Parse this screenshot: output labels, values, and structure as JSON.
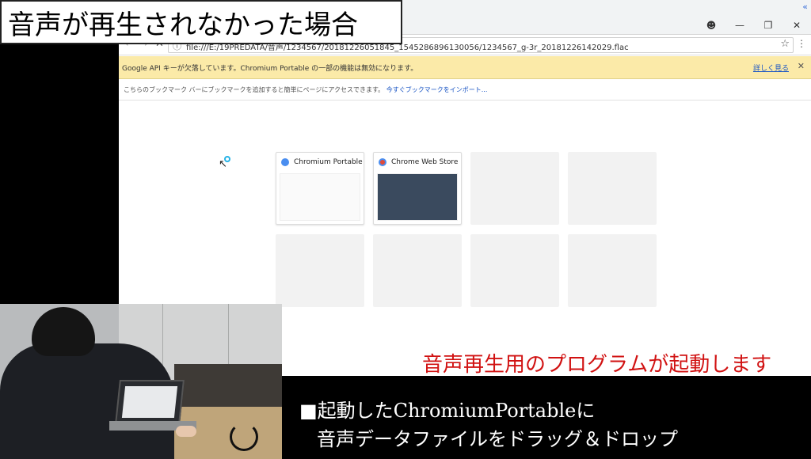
{
  "overlay": {
    "title": "音声が再生されなかった場合",
    "red_caption": "音声再生用のプログラムが起動します",
    "caption_line1": "■起動したChromiumPortableに",
    "caption_line2": "音声データファイルをドラッグ＆ドロップ"
  },
  "browser": {
    "url": "file:///E:/19PREDATA/音声/1234567/20181226051845_1545286896130056/1234567_g-3r_20181226142029.flac",
    "infobar_message": "Google API キーが欠落しています。Chromium Portable の一部の機能は無効になります。",
    "infobar_link": "詳しく見る",
    "bookmark_hint": "こちらのブックマーク バーにブックマークを追加すると簡単にページにアクセスできます。",
    "bookmark_link": "今すぐブックマークをインポート...",
    "tiles": [
      {
        "title": "Chromium Portable ..."
      },
      {
        "title": "Chrome Web Store"
      }
    ]
  },
  "icons": {
    "collapse": "collapse-icon",
    "account": "account-icon",
    "minimize": "minimize-icon",
    "restore": "restore-icon",
    "close": "close-icon",
    "back": "back-icon",
    "forward": "forward-icon",
    "reload": "close-icon",
    "info": "info-icon",
    "star": "star-icon",
    "menu": "menu-icon"
  },
  "colors": {
    "infobar_bg": "#fbeaa8",
    "link": "#1a55c4",
    "caption_red": "#d11212",
    "spinner": "#27b3e6"
  }
}
